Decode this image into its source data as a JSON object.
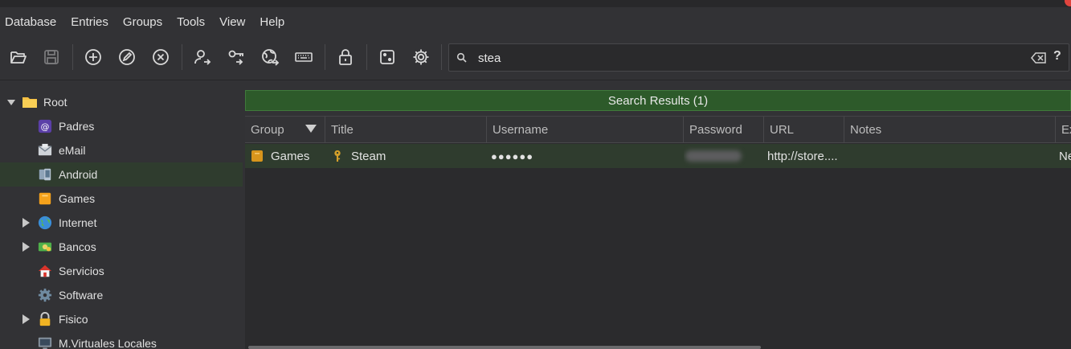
{
  "menubar": {
    "items": [
      "Database",
      "Entries",
      "Groups",
      "Tools",
      "View",
      "Help"
    ]
  },
  "toolbar": {
    "buttons": [
      {
        "name": "open-database-icon"
      },
      {
        "name": "save-database-icon"
      },
      {
        "name": "add-entry-icon"
      },
      {
        "name": "edit-entry-icon"
      },
      {
        "name": "delete-entry-icon"
      },
      {
        "name": "copy-username-icon"
      },
      {
        "name": "copy-password-icon"
      },
      {
        "name": "open-url-icon"
      },
      {
        "name": "autotype-keyboard-icon"
      },
      {
        "name": "lock-database-icon"
      },
      {
        "name": "password-generator-dice-icon"
      },
      {
        "name": "settings-gear-icon"
      }
    ]
  },
  "search": {
    "value": "stea",
    "help_label": "?"
  },
  "tree": {
    "items": [
      {
        "label": "Root",
        "icon": "folder-icon",
        "expanded": true,
        "level": 0
      },
      {
        "label": "Padres",
        "icon": "at-sign-icon",
        "level": 1
      },
      {
        "label": "eMail",
        "icon": "envelope-icon",
        "level": 1
      },
      {
        "label": "Android",
        "icon": "phone-icon",
        "level": 1,
        "selected": true
      },
      {
        "label": "Games",
        "icon": "box-icon",
        "level": 1
      },
      {
        "label": "Internet",
        "icon": "globe-icon",
        "level": 1,
        "collapsed": true
      },
      {
        "label": "Bancos",
        "icon": "money-icon",
        "level": 1,
        "collapsed": true
      },
      {
        "label": "Servicios",
        "icon": "house-icon",
        "level": 1
      },
      {
        "label": "Software",
        "icon": "gear-icon",
        "level": 1
      },
      {
        "label": "Fisico",
        "icon": "padlock-icon",
        "level": 1,
        "collapsed": true
      },
      {
        "label": "M.Virtuales Locales",
        "icon": "monitor-icon",
        "level": 1
      }
    ]
  },
  "results": {
    "banner": "Search Results (1)"
  },
  "table": {
    "columns": [
      "Group",
      "Title",
      "Username",
      "Password",
      "URL",
      "Notes",
      "Ex"
    ],
    "rows": [
      {
        "group": "Games",
        "title": "Steam",
        "username": "●●●●●●",
        "password_hidden": true,
        "url": "http://store....",
        "notes": "",
        "extra": "Ne"
      }
    ]
  },
  "colors": {
    "background": "#323235",
    "banner_green": "#2d5a2a",
    "selection_green": "#2f3c2e",
    "folder_yellow": "#f6c043",
    "key_gold": "#d4a02a"
  }
}
